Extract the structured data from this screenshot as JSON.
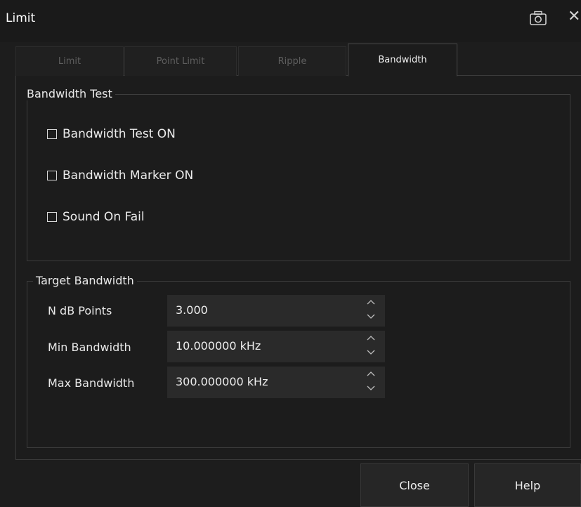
{
  "window": {
    "title": "Limit"
  },
  "tabs": [
    {
      "label": "Limit",
      "active": false
    },
    {
      "label": "Point Limit",
      "active": false
    },
    {
      "label": "Ripple",
      "active": false
    },
    {
      "label": "Bandwidth",
      "active": true
    }
  ],
  "bandwidth_test": {
    "title": "Bandwidth Test",
    "options": [
      {
        "label": "Bandwidth Test ON",
        "checked": false
      },
      {
        "label": "Bandwidth Marker ON",
        "checked": false
      },
      {
        "label": "Sound On Fail",
        "checked": false
      }
    ]
  },
  "target_bandwidth": {
    "title": "Target Bandwidth",
    "fields": [
      {
        "label": "N dB Points",
        "value": "3.000"
      },
      {
        "label": "Min Bandwidth",
        "value": "10.000000 kHz"
      },
      {
        "label": "Max Bandwidth",
        "value": "300.000000 kHz"
      }
    ]
  },
  "footer": {
    "close_label": "Close",
    "help_label": "Help"
  },
  "icons": {
    "camera": "camera-icon",
    "close": "close-icon"
  },
  "colors": {
    "background": "#1c1c1c",
    "field_bg": "#2a2a2a",
    "border": "#3d3d3d"
  }
}
